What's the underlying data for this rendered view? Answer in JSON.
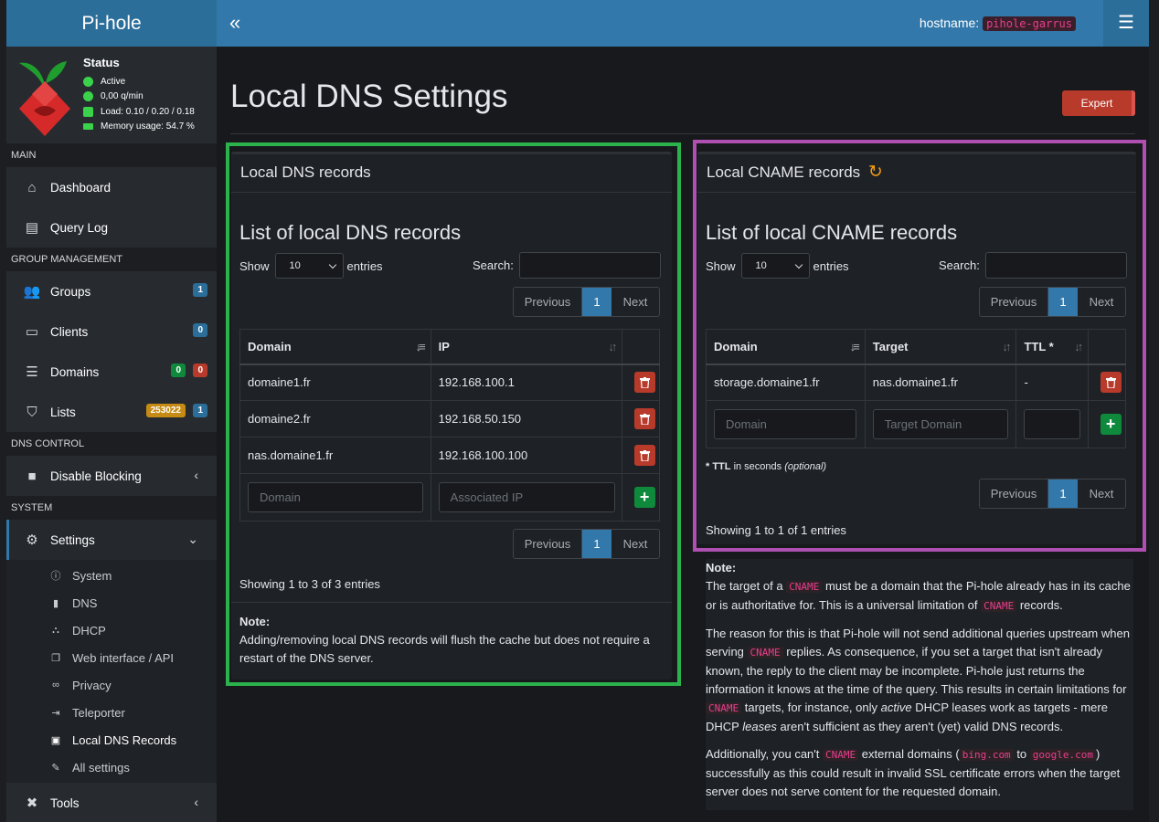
{
  "header": {
    "brand": "Pi-hole",
    "hostname_label": "hostname:",
    "hostname_value": "pihole-garrus"
  },
  "status": {
    "title": "Status",
    "active": "Active",
    "rate": "0,00 q/min",
    "load": "Load: 0.10 / 0.20 / 0.18",
    "memory": "Memory usage: 54.7 %"
  },
  "sidebar": {
    "sections": {
      "main": "MAIN",
      "group": "GROUP MANAGEMENT",
      "dns": "DNS CONTROL",
      "system": "SYSTEM"
    },
    "dashboard": "Dashboard",
    "query_log": "Query Log",
    "groups": "Groups",
    "groups_badge": "1",
    "clients": "Clients",
    "clients_badge": "0",
    "domains": "Domains",
    "domains_badge_allow": "0",
    "domains_badge_deny": "0",
    "lists": "Lists",
    "lists_badge_total": "253022",
    "lists_badge_count": "1",
    "disable_blocking": "Disable Blocking",
    "settings": "Settings",
    "sub": [
      "System",
      "DNS",
      "DHCP",
      "Web interface / API",
      "Privacy",
      "Teleporter",
      "Local DNS Records",
      "All settings"
    ],
    "tools": "Tools"
  },
  "page": {
    "title": "Local DNS Settings",
    "expert": "Expert"
  },
  "dns_box": {
    "title": "Local DNS records",
    "list_title": "List of local DNS records",
    "show": "Show",
    "entries": "entries",
    "page_size": "10",
    "search": "Search:",
    "prev": "Previous",
    "page": "1",
    "next": "Next",
    "col_domain": "Domain",
    "col_ip": "IP",
    "rows": [
      {
        "domain": "domaine1.fr",
        "ip": "192.168.100.1"
      },
      {
        "domain": "domaine2.fr",
        "ip": "192.168.50.150"
      },
      {
        "domain": "nas.domaine1.fr",
        "ip": "192.168.100.100"
      }
    ],
    "ph_domain": "Domain",
    "ph_ip": "Associated IP",
    "showing": "Showing 1 to 3 of 3 entries",
    "note_title": "Note:",
    "note_text": "Adding/removing local DNS records will flush the cache but does not require a restart of the DNS server."
  },
  "cname_box": {
    "title": "Local CNAME records",
    "list_title": "List of local CNAME records",
    "show": "Show",
    "entries": "entries",
    "page_size": "10",
    "search": "Search:",
    "prev": "Previous",
    "page": "1",
    "next": "Next",
    "col_domain": "Domain",
    "col_target": "Target",
    "col_ttl": "TTL *",
    "rows": [
      {
        "domain": "storage.domaine1.fr",
        "target": "nas.domaine1.fr",
        "ttl": "-"
      }
    ],
    "ph_domain": "Domain",
    "ph_target": "Target Domain",
    "ttl_note_bold": "* TTL",
    "ttl_note_rest": "in seconds",
    "ttl_note_opt": "(optional)",
    "showing": "Showing 1 to 1 of 1 entries"
  },
  "cname_note": {
    "title": "Note:",
    "p1a": "The target of a",
    "cname": "CNAME",
    "p1b": "must be a domain that the Pi-hole already has in its cache or is authoritative for. This is a universal limitation of",
    "p1c": "records.",
    "p2a": "The reason for this is that Pi-hole will not send additional queries upstream when serving",
    "p2b": "replies. As consequence, if you set a target that isn't already known, the reply to the client may be incomplete. Pi-hole just returns the information it knows at the time of the query. This results in certain limitations for",
    "p2c": "targets, for instance, only",
    "p2d": "active",
    "p2e": "DHCP leases work as targets - mere DHCP",
    "p2f": "leases",
    "p2g": "aren't sufficient as they aren't (yet) valid DNS records.",
    "p3a": "Additionally, you can't",
    "p3b": "external domains (",
    "bing": "bing.com",
    "to": "to",
    "google": "google.com",
    "p3c": ") successfully as this could result in invalid SSL certificate errors when the target server does not serve content for the requested domain."
  },
  "colors": {
    "outline_left": "#2bb24c",
    "outline_right": "#b04fb2",
    "accent": "#3278aa"
  }
}
